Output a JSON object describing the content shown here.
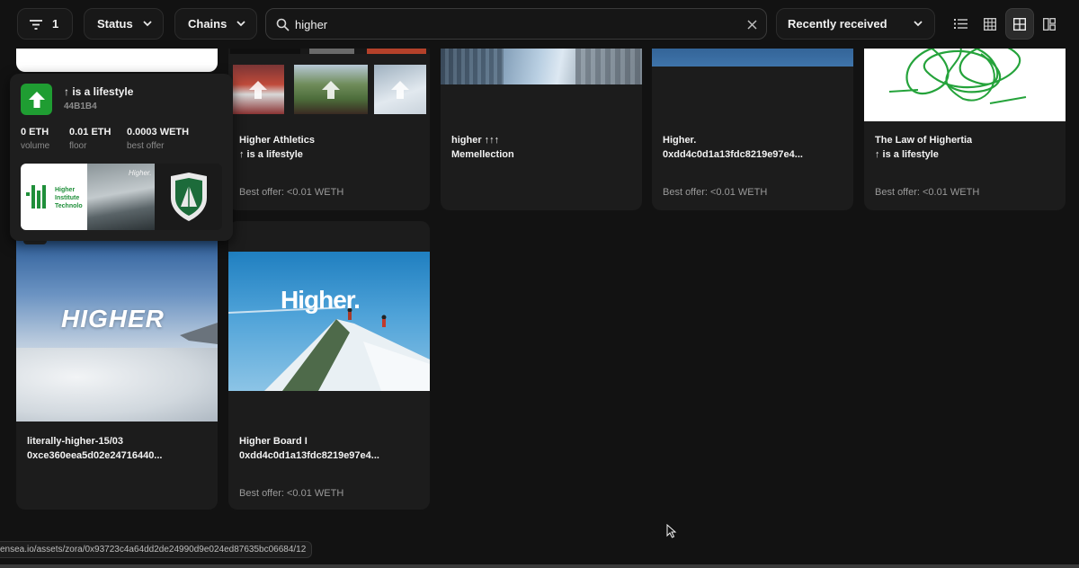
{
  "toolbar": {
    "filter_count": "1",
    "status_label": "Status",
    "chains_label": "Chains",
    "search_value": "higher",
    "sort_label": "Recently received",
    "views": [
      "list-view",
      "small-grid-view",
      "medium-grid-view",
      "large-grid-view"
    ],
    "active_view": "medium-grid-view"
  },
  "popup": {
    "collection_name": "↑ is a lifestyle",
    "address": "44B1B4",
    "stats": [
      {
        "value": "0 ETH",
        "label": "volume"
      },
      {
        "value": "0.01 ETH",
        "label": "floor"
      },
      {
        "value": "0.0003 WETH",
        "label": "best offer"
      }
    ],
    "preview_texts": [
      "Higher",
      "Institute",
      "Technolo",
      "Higher."
    ]
  },
  "cards": [
    {
      "title": "Higher Athletics",
      "subtitle": "↑ is a lifestyle",
      "offer": "Best offer: <0.01 WETH"
    },
    {
      "title": "higher ↑↑↑",
      "subtitle": "Memellection",
      "offer": ""
    },
    {
      "title": "Higher.",
      "subtitle": "0xdd4c0d1a13fdc8219e97e4...",
      "offer": "Best offer: <0.01 WETH"
    },
    {
      "title": "The Law of Highertia",
      "subtitle": "↑ is a lifestyle",
      "offer": "Best offer: <0.01 WETH"
    },
    {
      "title": "literally-higher-15/03",
      "subtitle": "0xce360eea5d02e24716440...",
      "offer": "",
      "image_text": "HIGHER"
    },
    {
      "title": "Higher Board I",
      "subtitle": "0xdd4c0d1a13fdc8219e97e4...",
      "offer": "Best offer: <0.01 WETH",
      "image_text": "Higher."
    }
  ],
  "status_url": "ensea.io/assets/zora/0x93723c4a64dd2de24990d9e024ed87635bc06684/12",
  "colors": {
    "background": "#121212",
    "card": "#1c1c1c",
    "accent_green": "#1f9d32"
  }
}
